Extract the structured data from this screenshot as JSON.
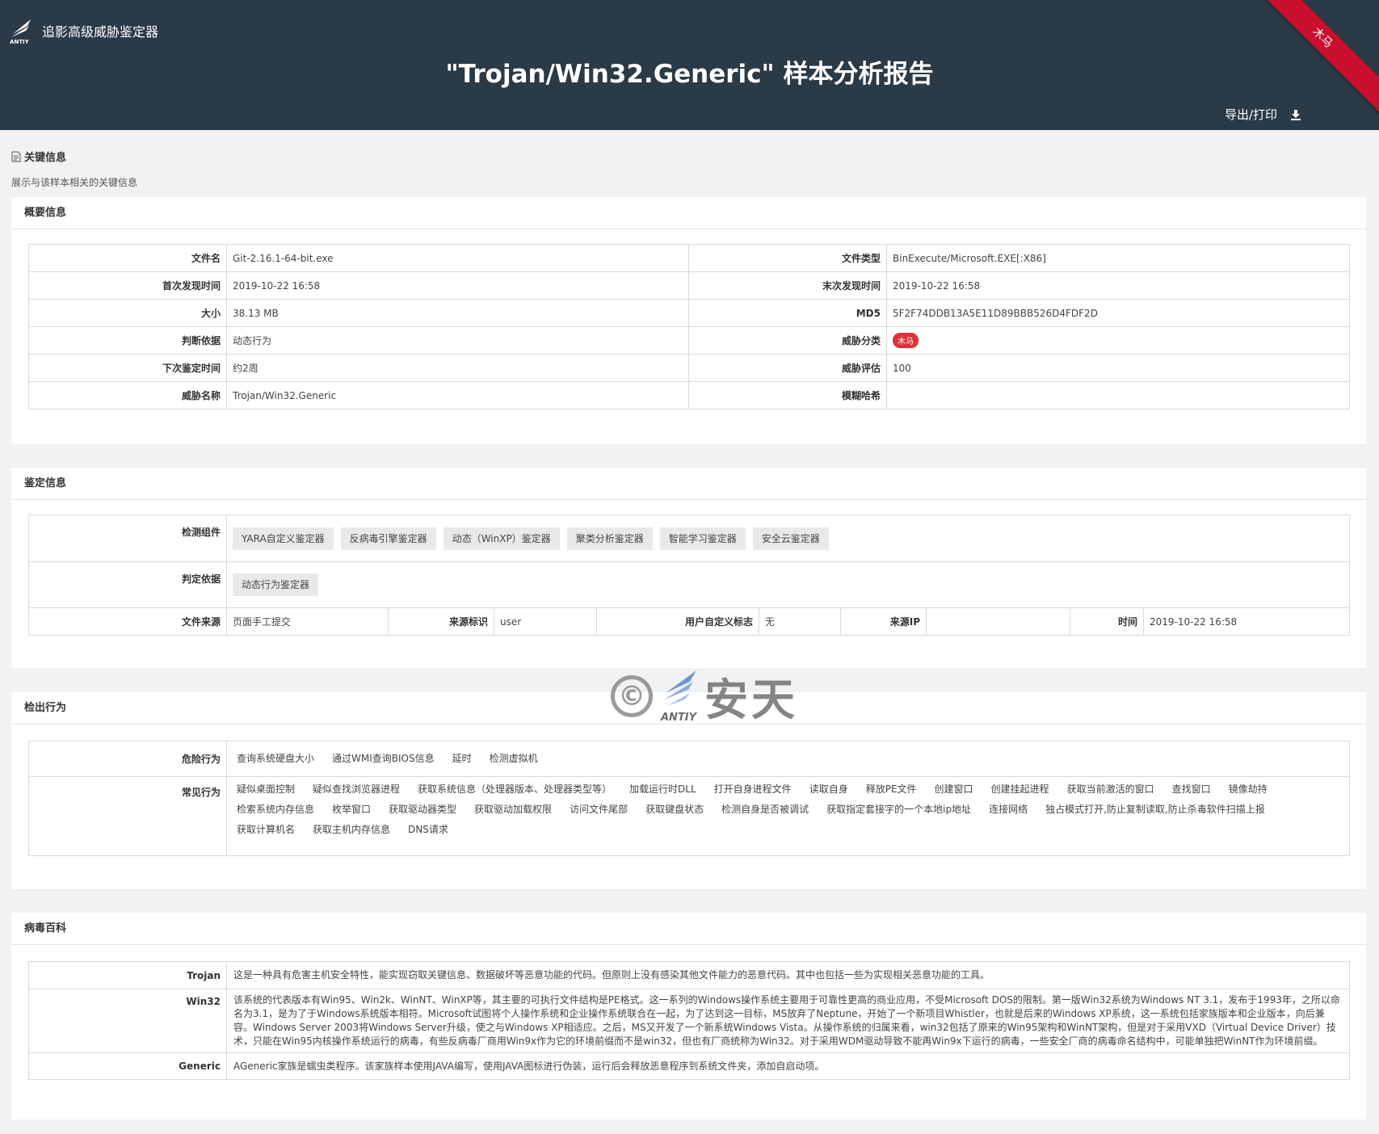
{
  "app": {
    "name": "追影高级威胁鉴定器",
    "logo_text": "ANTIY",
    "title": "\"Trojan/Win32.Generic\" 样本分析报告",
    "export_label": "导出/打印",
    "ribbon": "木马"
  },
  "key_info": {
    "title": "关键信息",
    "subtitle": "展示与该样本相关的关键信息"
  },
  "summary": {
    "title": "概要信息",
    "rows": [
      {
        "l1": "文件名",
        "v1": "Git-2.16.1-64-bit.exe",
        "l2": "文件类型",
        "v2": "BinExecute/Microsoft.EXE[:X86]"
      },
      {
        "l1": "首次发现时间",
        "v1": "2019-10-22 16:58",
        "l2": "末次发现时间",
        "v2": "2019-10-22 16:58"
      },
      {
        "l1": "大小",
        "v1": "38.13 MB",
        "l2": "MD5",
        "v2": "5F2F74DDB13A5E11D89BBB526D4FDF2D"
      },
      {
        "l1": "判断依据",
        "v1": "动态行为",
        "l2": "威胁分类",
        "v2": "木马"
      },
      {
        "l1": "下次鉴定时间",
        "v1": "约2周",
        "l2": "威胁评估",
        "v2": "100"
      },
      {
        "l1": "威胁名称",
        "v1": "Trojan/Win32.Generic",
        "l2": "模糊哈希",
        "v2": ""
      }
    ]
  },
  "identify": {
    "title": "鉴定信息",
    "components_label": "检测组件",
    "components": [
      "YARA自定义鉴定器",
      "反病毒引擎鉴定器",
      "动态（WinXP）鉴定器",
      "聚类分析鉴定器",
      "智能学习鉴定器",
      "安全云鉴定器"
    ],
    "basis_label": "判定依据",
    "basis": [
      "动态行为鉴定器"
    ],
    "source_label": "文件来源",
    "source_value": "页面手工提交",
    "tag_label": "来源标识",
    "tag_value": "user",
    "custom_label": "用户自定义标志",
    "custom_value": "无",
    "ip_label": "来源IP",
    "ip_value": "",
    "time_label": "时间",
    "time_value": "2019-10-22 16:58"
  },
  "behavior": {
    "title": "检出行为",
    "danger_label": "危险行为",
    "danger": [
      "查询系统硬盘大小",
      "通过WMI查询BIOS信息",
      "延时",
      "检测虚拟机"
    ],
    "common_label": "常见行为",
    "common": [
      "疑似桌面控制",
      "疑似查找浏览器进程",
      "获取系统信息（处理器版本、处理器类型等）",
      "加载运行时DLL",
      "打开自身进程文件",
      "读取自身",
      "释放PE文件",
      "创建窗口",
      "创建挂起进程",
      "获取当前激活的窗口",
      "查找窗口",
      "镜像劫持",
      "检索系统内存信息",
      "枚举窗口",
      "获取驱动器类型",
      "获取驱动加载权限",
      "访问文件尾部",
      "获取键盘状态",
      "检测自身是否被调试",
      "获取指定套接字的一个本地ip地址",
      "连接网络",
      "独占模式打开,防止复制读取,防止杀毒软件扫描上报",
      "获取计算机名",
      "获取主机内存信息",
      "DNS请求"
    ]
  },
  "wiki": {
    "title": "病毒百科",
    "items": [
      {
        "label": "Trojan",
        "text": "这是一种具有危害主机安全特性，能实现窃取关键信息、数据破坏等恶意功能的代码。但原则上没有感染其他文件能力的恶意代码。其中也包括一些为实现相关恶意功能的工具。"
      },
      {
        "label": "Win32",
        "text": "该系统的代表版本有Win95、Win2k、WinNT、WinXP等，其主要的可执行文件结构是PE格式。这一系列的Windows操作系统主要用于可靠性更高的商业应用，不受Microsoft DOS的限制。第一版Win32系统为Windows NT 3.1，发布于1993年，之所以命名为3.1，是为了于Windows系统版本相符。Microsoft试图将个人操作系统和企业操作系统联合在一起，为了达到这一目标，MS放弃了Neptune，开始了一个新项目Whistler，也就是后来的Windows XP系统，这一系统包括家族版本和企业版本，向后兼容。Windows Server 2003将Windows Server升级，使之与Windows XP相适应。之后，MS又开发了一个新系统Windows Vista。从操作系统的归属来看，win32包括了原来的Win95架构和WinNT架构，但是对于采用VXD（Virtual Device Driver）技术，只能在Win95内核操作系统运行的病毒，有些反病毒厂商用Win9x作为它的环境前缀而不是win32，但也有厂商统称为Win32。对于采用WDM驱动导致不能再Win9x下运行的病毒，一些安全厂商的病毒命名结构中，可能单独把WinNT作为环境前缀。"
      },
      {
        "label": "Generic",
        "text": "AGeneric家族是蠕虫类程序。该家族样本使用JAVA编写，使用JAVA图标进行伪装，运行后会释放恶意程序到系统文件夹，添加自启动项。"
      }
    ]
  },
  "watermark": {
    "symbol": "©",
    "brand": "ANTIY",
    "text": "安天"
  },
  "colors": {
    "header_bg": "#2b3a47",
    "threat_red": "#d9343a"
  }
}
